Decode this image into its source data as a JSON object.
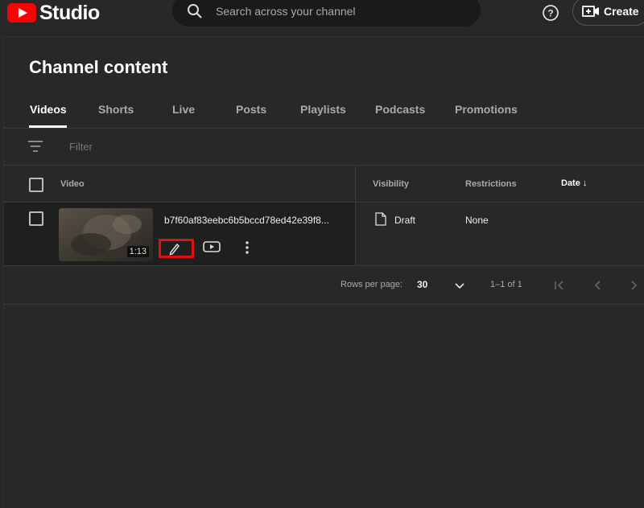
{
  "app": {
    "logo_text": "Studio"
  },
  "search": {
    "placeholder": "Search across your channel"
  },
  "header": {
    "create_label": "Create"
  },
  "page": {
    "title": "Channel content"
  },
  "tabs": [
    {
      "label": "Videos",
      "active": true
    },
    {
      "label": "Shorts"
    },
    {
      "label": "Live"
    },
    {
      "label": "Posts"
    },
    {
      "label": "Playlists"
    },
    {
      "label": "Podcasts"
    },
    {
      "label": "Promotions"
    }
  ],
  "filter": {
    "label": "Filter"
  },
  "table": {
    "columns": {
      "video": "Video",
      "visibility": "Visibility",
      "restrictions": "Restrictions",
      "date": "Date ↓"
    },
    "rows": [
      {
        "title": "b7f60af83eebc6b5bccd78ed42e39f8...",
        "duration": "1:13",
        "visibility": "Draft",
        "restrictions": "None"
      }
    ]
  },
  "pagination": {
    "rows_per_page_label": "Rows per page:",
    "rows_per_page": "30",
    "range": "1–1 of 1"
  },
  "colors": {
    "background": "#282828",
    "highlight": "#e01010",
    "brand": "#ff0000"
  },
  "icons": [
    "youtube-logo-icon",
    "search-icon",
    "help-icon",
    "create-video-icon",
    "filter-icon",
    "checkbox-icon",
    "pencil-icon",
    "youtube-play-icon",
    "more-vert-icon",
    "document-icon",
    "chevron-down-icon",
    "first-page-icon",
    "prev-page-icon",
    "next-page-icon"
  ]
}
